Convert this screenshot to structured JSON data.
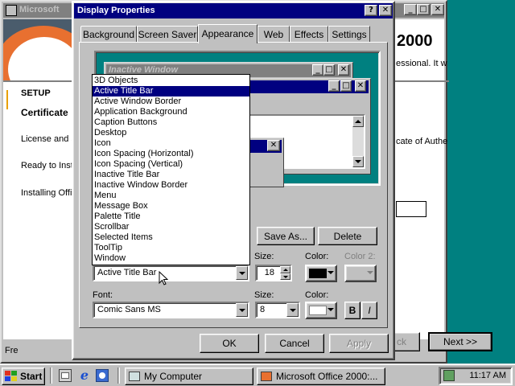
{
  "bg_window": {
    "title": "Microsoft",
    "header_text": "2000",
    "para1": "essional. It will guide you",
    "para2": "cate of Authenticity.",
    "next_label": "Next >>",
    "back_label": "ck",
    "side_items": [
      "SETUP",
      "Certificate",
      "License and S",
      "Ready to Inst",
      "Installing Offi"
    ],
    "footer_text": "Fre"
  },
  "dialog": {
    "title": "Display Properties",
    "tabs": [
      "Background",
      "Screen Saver",
      "Appearance",
      "Web",
      "Effects",
      "Settings"
    ],
    "active_tab": "Appearance",
    "preview": {
      "inactive_title": "Inactive Window"
    },
    "scheme_buttons": {
      "save_as": "Save As...",
      "delete": "Delete"
    },
    "item_list": {
      "options": [
        "3D Objects",
        "Active Title Bar",
        "Active Window Border",
        "Application Background",
        "Caption Buttons",
        "Desktop",
        "Icon",
        "Icon Spacing (Horizontal)",
        "Icon Spacing (Vertical)",
        "Inactive Title Bar",
        "Inactive Window Border",
        "Menu",
        "Message Box",
        "Palette Title",
        "Scrollbar",
        "Selected Items",
        "ToolTip",
        "Window"
      ],
      "selected": "Active Title Bar"
    },
    "item": {
      "value": "Active Title Bar",
      "size_label": "Size:",
      "size_value": "18",
      "color_label": "Color:",
      "color2_label": "Color 2:"
    },
    "font": {
      "label": "Font:",
      "value": "Comic Sans MS",
      "size_label": "Size:",
      "size_value": "8",
      "color_label": "Color:",
      "bold": "B",
      "italic": "I"
    },
    "buttons": {
      "ok": "OK",
      "cancel": "Cancel",
      "apply": "Apply"
    }
  },
  "taskbar": {
    "start": "Start",
    "tasks": [
      "My Computer",
      "Microsoft Office 2000:..."
    ],
    "clock": "11:17 AM"
  }
}
